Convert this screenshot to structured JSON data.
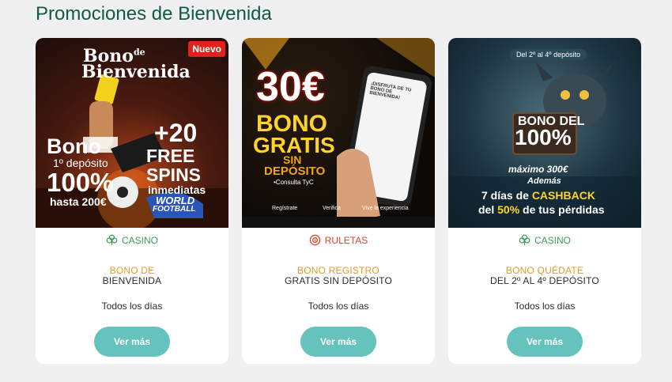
{
  "section": {
    "title": "Promociones de Bienvenida"
  },
  "cards": [
    {
      "banner": {
        "badge": "Nuevo",
        "title_line1": "Bono",
        "title_line1_sup": "de",
        "title_line2": "Bienvenida",
        "bono": "Bono",
        "deposito": "1º depósito",
        "percent": "100%",
        "hasta": "hasta 200€",
        "plus": "+20",
        "free": "FREE",
        "spins": "SPINS",
        "inmediatas": "inmediatas",
        "world": "WORLD",
        "football": "FOOTBALL"
      },
      "category": {
        "label": "CASINO",
        "icon": "clover-icon"
      },
      "bono_line1": "BONO DE",
      "bono_line2": "BIENVENIDA",
      "frequency": "Todos los días",
      "button": "Ver más"
    },
    {
      "banner": {
        "amount": "30€",
        "bono": "BONO",
        "gratis": "GRATIS",
        "sin": "SIN",
        "deposito": "DEPÓSITO",
        "consulta": "•Consulta TyC",
        "step1": "Regístrate",
        "step2": "Verifica",
        "step3": "Vive la experiencia",
        "phone_title": "¡DISFRUTA DE TU BONO DE BIENVENIDA!"
      },
      "category": {
        "label": "RULETAS",
        "icon": "roulette-icon"
      },
      "bono_line1": "BONO REGISTRO",
      "bono_line2": "GRATIS SIN DEPÓSITO",
      "frequency": "Todos los días",
      "button": "Ver más"
    },
    {
      "banner": {
        "ribbon": "Del 2º al 4º depósito",
        "bono_del": "BONO DEL",
        "percent": "100%",
        "maximo": "máximo 300€",
        "ademas": "Además",
        "line1_pre": "7 días de ",
        "cashback": "CASHBACK",
        "line2_pre": "del ",
        "line2_pct": "50%",
        "line2_post": " de tus pérdidas"
      },
      "category": {
        "label": "CASINO",
        "icon": "clover-icon"
      },
      "bono_line1": "BONO QUÉDATE",
      "bono_line2": "DEL 2º AL 4º DEPÓSITO",
      "frequency": "Todos los días",
      "button": "Ver más"
    }
  ],
  "colors": {
    "title": "#0f5a4a",
    "casino": "#3f9b5a",
    "ruleta": "#d9442c",
    "bono_accent": "#e39a2a",
    "button": "#66c2bd"
  }
}
